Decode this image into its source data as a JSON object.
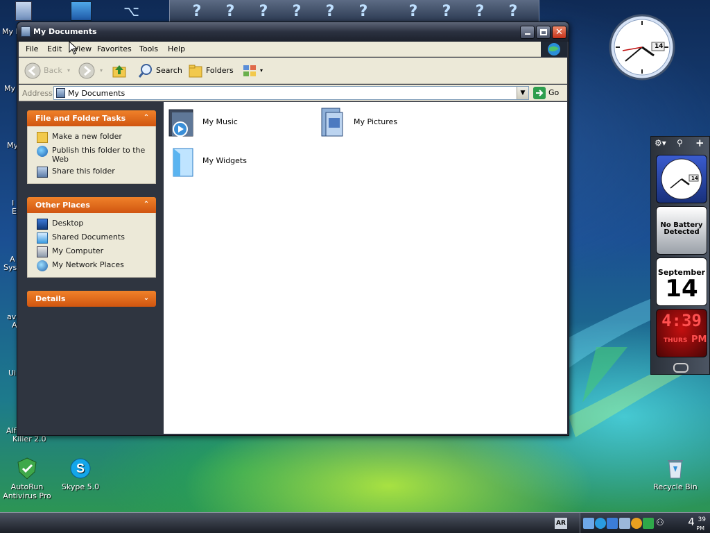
{
  "window": {
    "title": "My Documents"
  },
  "menu": [
    "File",
    "Edit",
    "View",
    "Favorites",
    "Tools",
    "Help"
  ],
  "toolbar": {
    "back": "Back",
    "search": "Search",
    "folders": "Folders"
  },
  "address": {
    "label": "Address",
    "value": "My Documents",
    "go": "Go"
  },
  "taskpane": {
    "file_tasks": {
      "title": "File and Folder Tasks",
      "items": [
        "Make a new folder",
        "Publish this folder to the Web",
        "Share this folder"
      ]
    },
    "other_places": {
      "title": "Other Places",
      "items": [
        "Desktop",
        "Shared Documents",
        "My Computer",
        "My Network Places"
      ]
    },
    "details": {
      "title": "Details"
    }
  },
  "files": [
    {
      "name": "My Music"
    },
    {
      "name": "My Pictures"
    },
    {
      "name": "My Widgets"
    }
  ],
  "desktop": {
    "icons": [
      {
        "label": "AutoRun Antivirus Pro"
      },
      {
        "label": "Skype 5.0"
      },
      {
        "label": "Recycle Bin"
      }
    ],
    "left_labels": [
      "My I",
      "My",
      "My",
      "I",
      "E",
      "A",
      "Sys",
      "av",
      "A",
      "Ui",
      "Alf",
      "Killer 2.0"
    ]
  },
  "gadgets": {
    "clock_date": "14",
    "battery": "No Battery Detected",
    "calendar_month": "September",
    "calendar_day": "14",
    "digital_time": "4:39",
    "digital_day": "THURS",
    "digital_ampm": "PM"
  },
  "taskbar": {
    "lang": "AR",
    "clock_hour": "4",
    "clock_min": "39",
    "clock_ampm": "PM"
  },
  "colors": {
    "task_header": "#e8701c",
    "close_button": "#d9462a",
    "content_bg": "#ffffff",
    "taskpane_bg": "#2f3540"
  }
}
